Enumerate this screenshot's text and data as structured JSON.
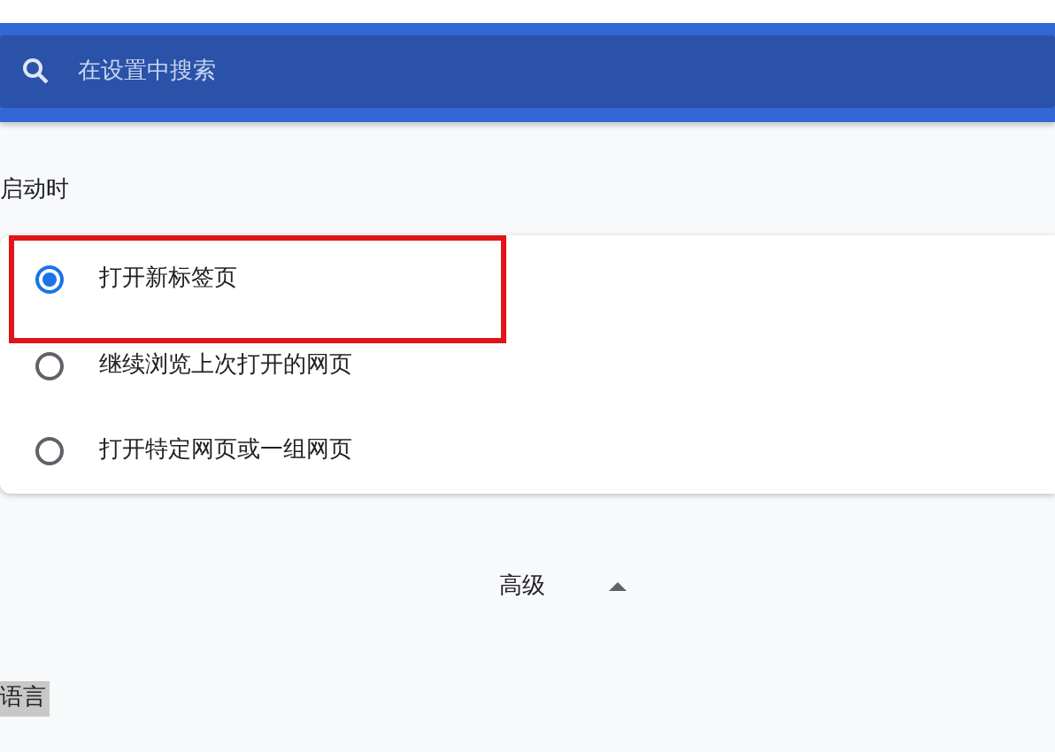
{
  "search": {
    "placeholder": "在设置中搜索"
  },
  "startup": {
    "heading": "启动时",
    "options": [
      {
        "label": "打开新标签页",
        "selected": true,
        "highlighted": true
      },
      {
        "label": "继续浏览上次打开的网页",
        "selected": false,
        "highlighted": false
      },
      {
        "label": "打开特定网页或一组网页",
        "selected": false,
        "highlighted": false
      }
    ]
  },
  "advanced": {
    "label": "高级",
    "expanded": true
  },
  "language": {
    "heading": "语言",
    "highlighted": true
  }
}
